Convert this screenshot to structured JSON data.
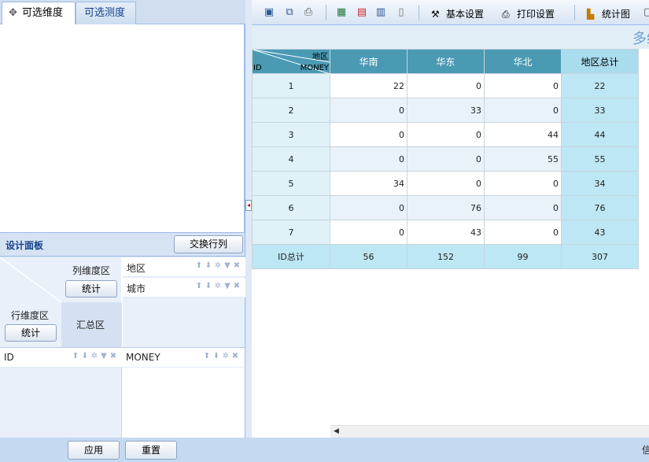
{
  "tabs": {
    "dimensions": "可选维度",
    "measures": "可选测度"
  },
  "design": {
    "title": "设计面板",
    "swap_label": "交换行列",
    "col_dim_label": "列维度区",
    "row_dim_label": "行维度区",
    "summary_label": "汇总区",
    "stat_label": "统计",
    "col_fields": [
      "地区",
      "城市"
    ],
    "row_fields": [
      "ID"
    ],
    "measure_fields": [
      "MONEY"
    ]
  },
  "toolbar": {
    "basic_settings": "基本设置",
    "print_settings": "打印设置",
    "chart": "统计图"
  },
  "report": {
    "title": "多维",
    "corner_col": "地区",
    "corner_row": "ID",
    "corner_measure": "MONEY",
    "columns": [
      "华南",
      "华东",
      "华北"
    ],
    "total_col_label": "地区总计",
    "rows": [
      {
        "id": "1",
        "values": [
          "22",
          "0",
          "0"
        ],
        "total": "22"
      },
      {
        "id": "2",
        "values": [
          "0",
          "33",
          "0"
        ],
        "total": "33"
      },
      {
        "id": "3",
        "values": [
          "0",
          "0",
          "44"
        ],
        "total": "44"
      },
      {
        "id": "4",
        "values": [
          "0",
          "0",
          "55"
        ],
        "total": "55"
      },
      {
        "id": "5",
        "values": [
          "34",
          "0",
          "0"
        ],
        "total": "34"
      },
      {
        "id": "6",
        "values": [
          "0",
          "76",
          "0"
        ],
        "total": "76"
      },
      {
        "id": "7",
        "values": [
          "0",
          "43",
          "0"
        ],
        "total": "43"
      }
    ],
    "totals": {
      "label": "ID总计",
      "values": [
        "56",
        "152",
        "99"
      ],
      "grand": "307"
    }
  },
  "bottom": {
    "apply": "应用",
    "reset": "重置",
    "status": "信"
  },
  "colors": {
    "header_bg": "#4a9ab4",
    "total_bg": "#bde7f4",
    "panel_bg": "#dfe8f6"
  }
}
